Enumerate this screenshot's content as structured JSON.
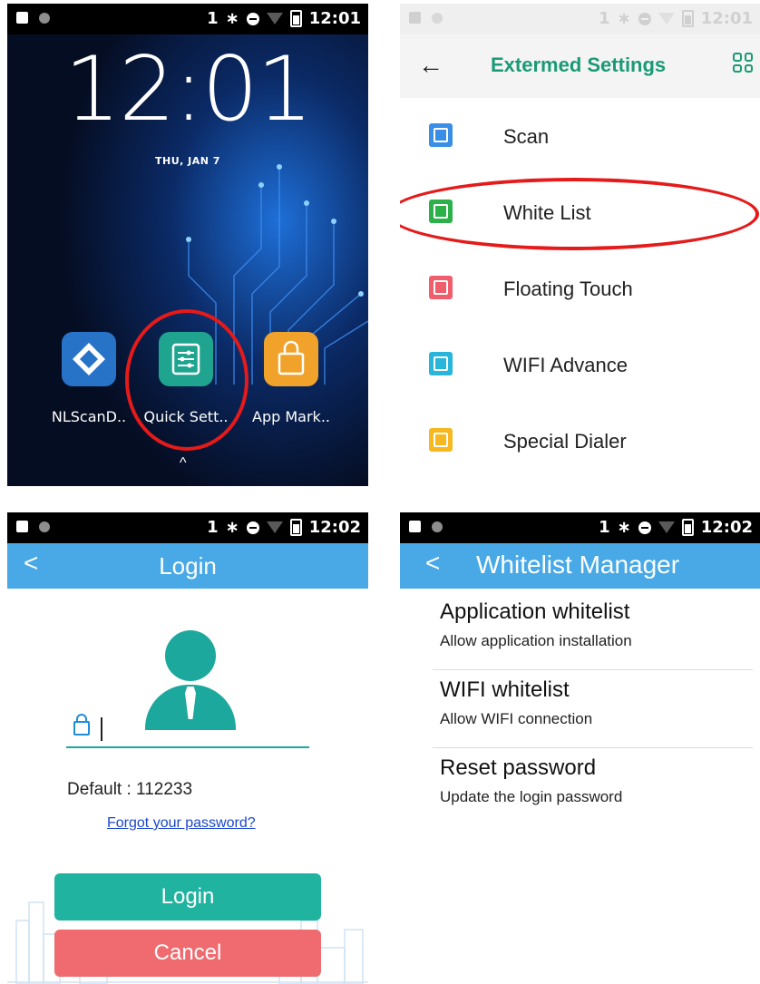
{
  "home": {
    "status": {
      "left_icons": [
        "image-icon",
        "dot-icon"
      ],
      "sim": "1",
      "time": "12:01"
    },
    "clock": "12:01",
    "date": "THU, JAN 7",
    "apps": [
      {
        "label": "NLScanD..",
        "icon": "nlscan-icon",
        "color": "#2673c7"
      },
      {
        "label": "Quick Sett..",
        "icon": "quick-settings-icon",
        "color": "#1fa58f"
      },
      {
        "label": "App Mark..",
        "icon": "shopping-bag-icon",
        "color": "#f0a22a"
      }
    ],
    "drawer_arrow": "^"
  },
  "settings": {
    "status": {
      "sim": "1",
      "time": "12:01"
    },
    "back": "←",
    "title": "Extermed Settings",
    "items": [
      {
        "label": "Scan",
        "icon": "scan-icon",
        "color": "#3a8ee6"
      },
      {
        "label": "White List",
        "icon": "white-list-icon",
        "color": "#2bb04a"
      },
      {
        "label": "Floating Touch",
        "icon": "floating-touch-icon",
        "color": "#ef5e6a"
      },
      {
        "label": "WIFI Advance",
        "icon": "wifi-advance-icon",
        "color": "#27b5d9"
      },
      {
        "label": "Special Dialer",
        "icon": "dialer-icon",
        "color": "#f6b820"
      }
    ]
  },
  "login": {
    "status": {
      "sim": "1",
      "time": "12:02"
    },
    "back": "<",
    "title": "Login",
    "default_hint": "Default : 112233",
    "forgot": "Forgot your password?",
    "login_button": "Login",
    "cancel_button": "Cancel"
  },
  "whitelist": {
    "status": {
      "sim": "1",
      "time": "12:02"
    },
    "back": "<",
    "title": "Whitelist Manager",
    "items": [
      {
        "title": "Application whitelist",
        "subtitle": "Allow application installation"
      },
      {
        "title": "WIFI whitelist",
        "subtitle": "Allow WIFI connection"
      },
      {
        "title": "Reset password",
        "subtitle": "Update the login password"
      }
    ]
  },
  "colors": {
    "highlight": "#e51a1a",
    "teal": "#1ca89c",
    "header_blue": "#48a9e6",
    "green_title": "#1a9a76"
  }
}
